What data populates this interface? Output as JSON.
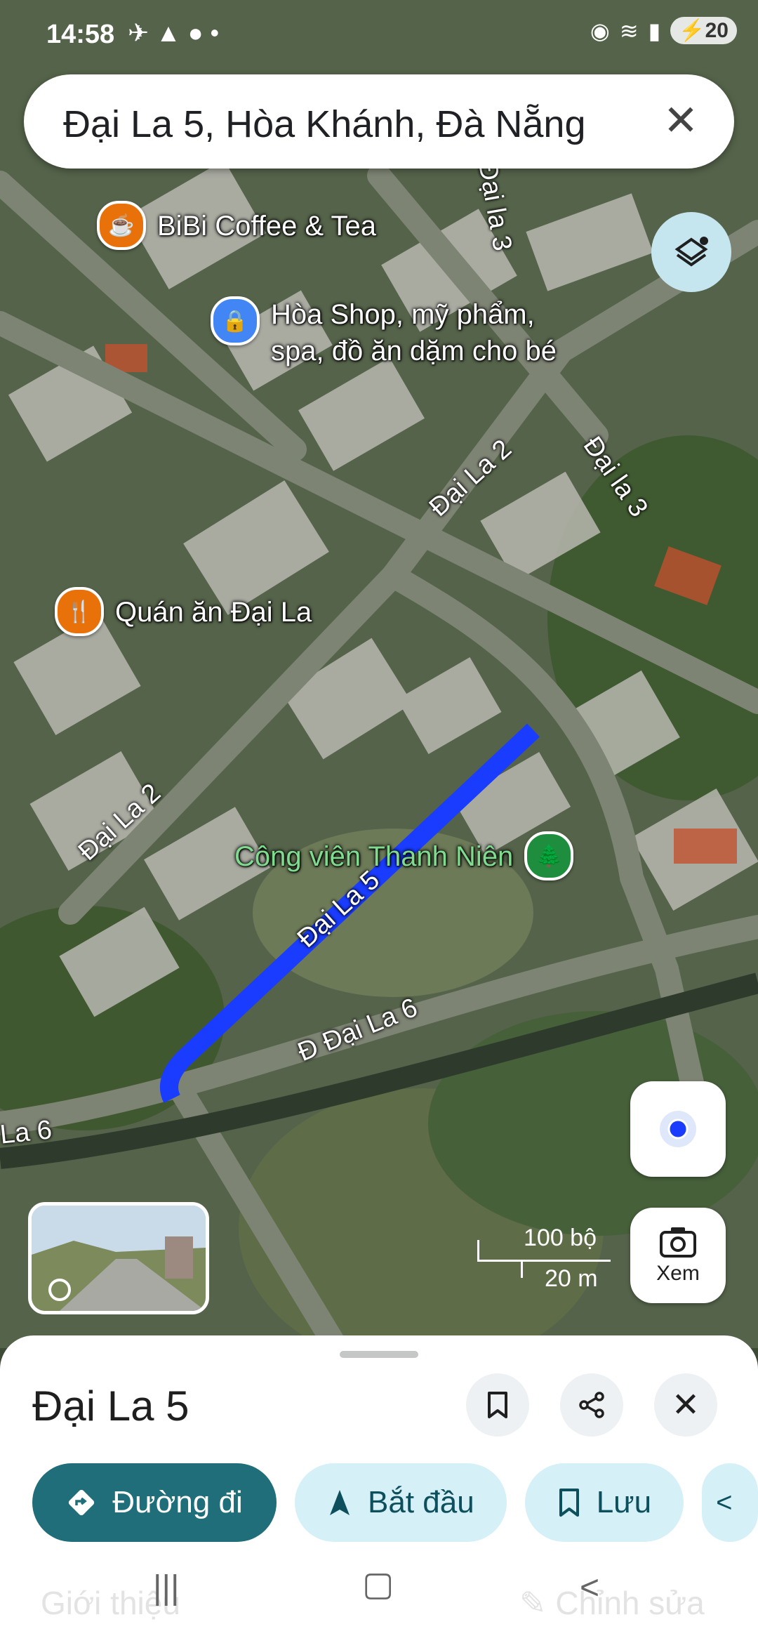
{
  "status_bar": {
    "time": "14:58",
    "battery": "20"
  },
  "search": {
    "query": "Đại La 5, Hòa Khánh, Đà Nẵng"
  },
  "places": [
    {
      "name": "BiBi Coffee & Tea",
      "icon": "coffee-icon",
      "color": "#e8710a"
    },
    {
      "name_line1": "Hòa Shop, mỹ phẩm,",
      "name_line2": "spa, đồ ăn dặm cho bé",
      "icon": "shopping-bag-icon",
      "color": "#4285f4"
    },
    {
      "name": "Quán ăn Đại La",
      "icon": "restaurant-icon",
      "color": "#e8710a"
    },
    {
      "name": "Công viên Thanh Niên",
      "icon": "tree-icon",
      "color": "#1e8e3e"
    }
  ],
  "road_labels": {
    "dai_la_3_top": "Đại la 3",
    "dai_la_2_upper": "Đại La 2",
    "dai_la_3_right": "Đại la 3",
    "dai_la_2_left": "Đại La 2",
    "dai_la_5": "Đại La 5",
    "dai_la_6": "Đ Đại La 6",
    "dai_la_6_edge": "La 6"
  },
  "scale": {
    "imperial": "100 bộ",
    "metric": "20 m"
  },
  "view_button": {
    "label": "Xem"
  },
  "sheet": {
    "title": "Đại La 5",
    "chips": {
      "directions": "Đường đi",
      "start": "Bắt đầu",
      "save": "Lưu"
    },
    "tab_about": "Giới thiệu",
    "edit": "Chỉnh sửa"
  },
  "colors": {
    "route": "#1a3cff",
    "accent": "#1f6e79",
    "chip_bg": "#d6f0f7"
  }
}
